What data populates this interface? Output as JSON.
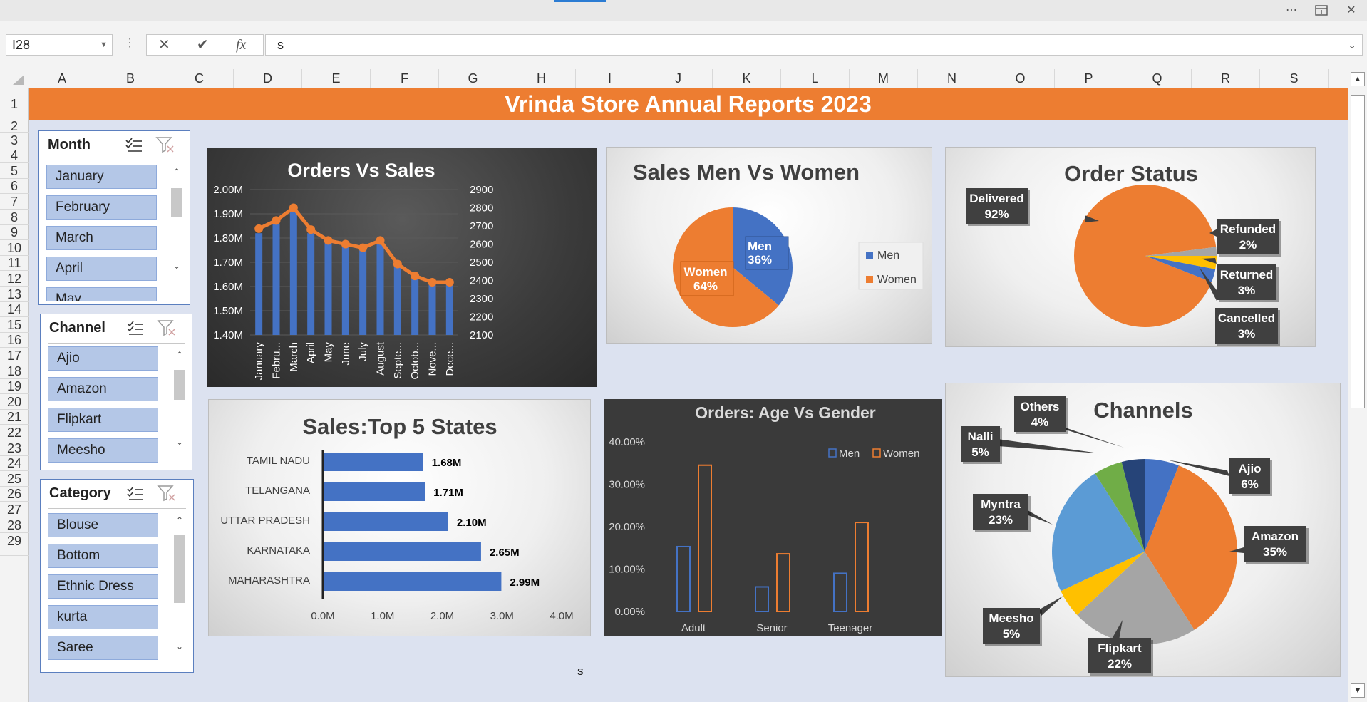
{
  "window": {
    "more_icon": "more-horizontal-icon",
    "restore_icon": "restore-window-icon",
    "close_icon": "close-icon"
  },
  "formula_bar": {
    "name_box": "I28",
    "cancel_icon": "cancel-icon",
    "enter_icon": "checkmark-icon",
    "function_label": "fx",
    "formula": "s"
  },
  "columns": [
    "A",
    "B",
    "C",
    "D",
    "E",
    "F",
    "G",
    "H",
    "I",
    "J",
    "K",
    "L",
    "M",
    "N",
    "O",
    "P",
    "Q",
    "R",
    "S"
  ],
  "rows": [
    "1",
    "2",
    "3",
    "4",
    "5",
    "6",
    "7",
    "8",
    "9",
    "10",
    "11",
    "12",
    "13",
    "14",
    "15",
    "16",
    "17",
    "18",
    "19",
    "20",
    "21",
    "22",
    "23",
    "24",
    "25",
    "26",
    "27",
    "28",
    "29"
  ],
  "report_title": "Vrinda Store Annual Reports 2023",
  "cell_I28": "s",
  "slicers": [
    {
      "title": "Month",
      "items": [
        "January",
        "February",
        "March",
        "April",
        "May"
      ]
    },
    {
      "title": "Channel",
      "items": [
        "Ajio",
        "Amazon",
        "Flipkart",
        "Meesho"
      ]
    },
    {
      "title": "Category",
      "items": [
        "Blouse",
        "Bottom",
        "Ethnic Dress",
        "kurta",
        "Saree"
      ]
    }
  ],
  "chart_data": [
    {
      "id": "orders-vs-sales",
      "type": "bar",
      "title": "Orders Vs Sales",
      "categories": [
        "January",
        "February",
        "March",
        "April",
        "May",
        "June",
        "July",
        "August",
        "September",
        "October",
        "November",
        "December"
      ],
      "category_labels": [
        "January",
        "Febru...",
        "March",
        "April",
        "May",
        "June",
        "July",
        "August",
        "Septe...",
        "Octob...",
        "Nove...",
        "Dece..."
      ],
      "series": [
        {
          "kind": "bar",
          "axis": "left",
          "values": [
            1.82,
            1.86,
            1.93,
            1.82,
            1.78,
            1.77,
            1.76,
            1.78,
            1.69,
            1.63,
            1.61,
            1.61
          ]
        },
        {
          "kind": "line",
          "axis": "right",
          "values": [
            2685,
            2730,
            2800,
            2680,
            2620,
            2600,
            2580,
            2620,
            2490,
            2425,
            2390,
            2390
          ]
        }
      ],
      "ylim_left": [
        1.4,
        2.0
      ],
      "yticks_left": [
        "1.40M",
        "1.50M",
        "1.60M",
        "1.70M",
        "1.80M",
        "1.90M",
        "2.00M"
      ],
      "ylim_right": [
        2100,
        2900
      ],
      "yticks_right": [
        "2100",
        "2200",
        "2300",
        "2400",
        "2500",
        "2600",
        "2700",
        "2800",
        "2900"
      ],
      "colors": {
        "bar": "#4472c4",
        "line": "#ed7d31"
      }
    },
    {
      "id": "sales-men-women",
      "type": "pie",
      "title": "Sales Men Vs  Women",
      "labels": [
        "Men",
        "Women"
      ],
      "values": [
        36,
        64
      ],
      "value_labels": [
        "36%",
        "64%"
      ],
      "colors": [
        "#4472c4",
        "#ed7d31"
      ],
      "legend": "right"
    },
    {
      "id": "order-status",
      "type": "pie",
      "title": "Order Status",
      "labels": [
        "Delivered",
        "Refunded",
        "Returned",
        "Cancelled"
      ],
      "values": [
        92,
        2,
        3,
        3
      ],
      "value_labels": [
        "92%",
        "2%",
        "3%",
        "3%"
      ],
      "colors": [
        "#ed7d31",
        "#a5a5a5",
        "#ffc000",
        "#4472c4"
      ]
    },
    {
      "id": "top-5-states",
      "type": "bar",
      "title": "Sales:Top 5 States",
      "categories": [
        "TAMIL NADU",
        "TELANGANA",
        "UTTAR PRADESH",
        "KARNATAKA",
        "MAHARASHTRA"
      ],
      "values": [
        1.68,
        1.71,
        2.1,
        2.65,
        2.99
      ],
      "value_labels": [
        "1.68M",
        "1.71M",
        "2.10M",
        "2.65M",
        "2.99M"
      ],
      "xlim": [
        0,
        4
      ],
      "xticks": [
        "0.0M",
        "1.0M",
        "2.0M",
        "3.0M",
        "4.0M"
      ],
      "orientation": "horizontal",
      "colors": {
        "bar": "#4472c4"
      }
    },
    {
      "id": "age-vs-gender",
      "type": "bar",
      "title": "Orders: Age Vs Gender",
      "categories": [
        "Adult",
        "Senior",
        "Teenager"
      ],
      "series": [
        {
          "name": "Men",
          "values": [
            15.3,
            5.8,
            9.0
          ]
        },
        {
          "name": "Women",
          "values": [
            34.5,
            13.6,
            21.0
          ]
        }
      ],
      "ylim": [
        0,
        40
      ],
      "yticks": [
        "0.00%",
        "10.00%",
        "20.00%",
        "30.00%",
        "40.00%"
      ],
      "legend": "top-right",
      "colors": {
        "Men": "#4472c4",
        "Women": "#ed7d31"
      }
    },
    {
      "id": "channels",
      "type": "pie",
      "title": "Channels",
      "labels": [
        "Ajio",
        "Amazon",
        "Flipkart",
        "Meesho",
        "Myntra",
        "Nalli",
        "Others"
      ],
      "values": [
        6,
        35,
        22,
        5,
        23,
        5,
        4
      ],
      "value_labels": [
        "6%",
        "35%",
        "22%",
        "5%",
        "23%",
        "5%",
        "4%"
      ],
      "colors": [
        "#4472c4",
        "#ed7d31",
        "#a5a5a5",
        "#ffc000",
        "#5b9bd5",
        "#70ad47",
        "#264478"
      ]
    }
  ]
}
